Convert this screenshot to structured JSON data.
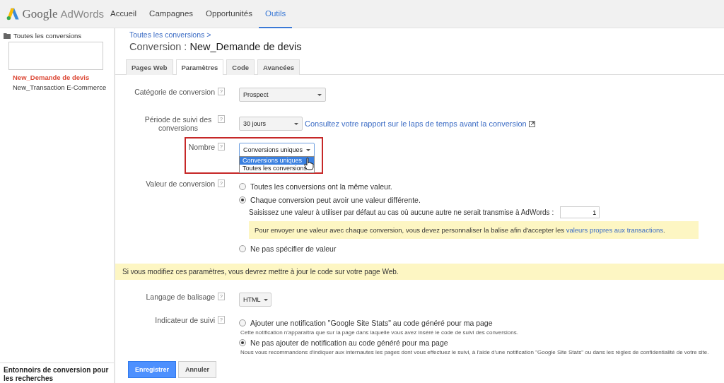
{
  "header": {
    "logo_google": "Google",
    "logo_product": "AdWords",
    "nav": [
      {
        "label": "Accueil",
        "selected": false
      },
      {
        "label": "Campagnes",
        "selected": false
      },
      {
        "label": "Opportunités",
        "selected": false
      },
      {
        "label": "Outils",
        "selected": true
      }
    ]
  },
  "sidebar": {
    "folder": "Toutes les conversions",
    "items": [
      {
        "label": "New_Demande de devis",
        "selected": true
      },
      {
        "label": "New_Transaction E-Commerce",
        "selected": false
      }
    ],
    "footer": "Entonnoirs de conversion pour les recherches"
  },
  "breadcrumb": "Toutes les conversions >",
  "title_prefix": "Conversion :",
  "title": "New_Demande de devis",
  "tabs": [
    {
      "label": "Pages Web",
      "selected": false
    },
    {
      "label": "Paramètres",
      "selected": true
    },
    {
      "label": "Code",
      "selected": false
    },
    {
      "label": "Avancées",
      "selected": false
    }
  ],
  "category": {
    "label": "Catégorie de conversion",
    "help": "?",
    "value": "Prospect"
  },
  "period": {
    "label": "Période de suivi des conversions",
    "help": "?",
    "value": "30 jours",
    "link": "Consultez votre rapport sur le laps de temps avant la conversion"
  },
  "count": {
    "label": "Nombre",
    "help": "?",
    "value": "Conversions uniques",
    "highlighted": true,
    "expanded": true,
    "options": [
      {
        "label": "Conversions uniques",
        "selected": true
      },
      {
        "label": "Toutes les conversions",
        "selected": false
      }
    ]
  },
  "conversion_value": {
    "label": "Valeur de conversion",
    "help": "?",
    "options": [
      {
        "label": "Toutes les conversions ont la même valeur.",
        "selected": false
      },
      {
        "label": "Chaque conversion peut avoir une valeur différente.",
        "selected": true
      },
      {
        "label": "Ne pas spécifier de valeur",
        "selected": false
      }
    ],
    "default_prompt": "Saisissez une valeur à utiliser par défaut au cas où aucune autre ne serait transmise à AdWords :",
    "default_value": "1",
    "note": "Pour envoyer une valeur avec chaque conversion, vous devez personnaliser la balise afin d'accepter les",
    "note_link": "valeurs propres aux transactions",
    "note_end": "."
  },
  "warning": "Si vous modifiez ces paramètres, vous devrez mettre à jour le code sur votre page Web.",
  "markup": {
    "label": "Langage de balisage",
    "help": "?",
    "value": "HTML"
  },
  "tracking": {
    "label": "Indicateur de suivi",
    "help": "?",
    "options": [
      {
        "label": "Ajouter une notification \"Google Site Stats\" au code généré pour ma page",
        "selected": false,
        "hint": "Cette notification n'apparaîtra que sur la page dans laquelle vous avez inséré le code de suivi des conversions."
      },
      {
        "label": "Ne pas ajouter de notification au code généré pour ma page",
        "selected": true,
        "hint": "Nous vous recommandons d'indiquer aux internautes les pages dont vous effectuez le suivi, à l'aide d'une notification \"Google Site Stats\" ou dans les règles de confidentialité de votre site."
      }
    ]
  },
  "buttons": [
    {
      "label": "Enregistrer",
      "kind": "primary"
    },
    {
      "label": "Annuler",
      "kind": "secondary"
    }
  ]
}
